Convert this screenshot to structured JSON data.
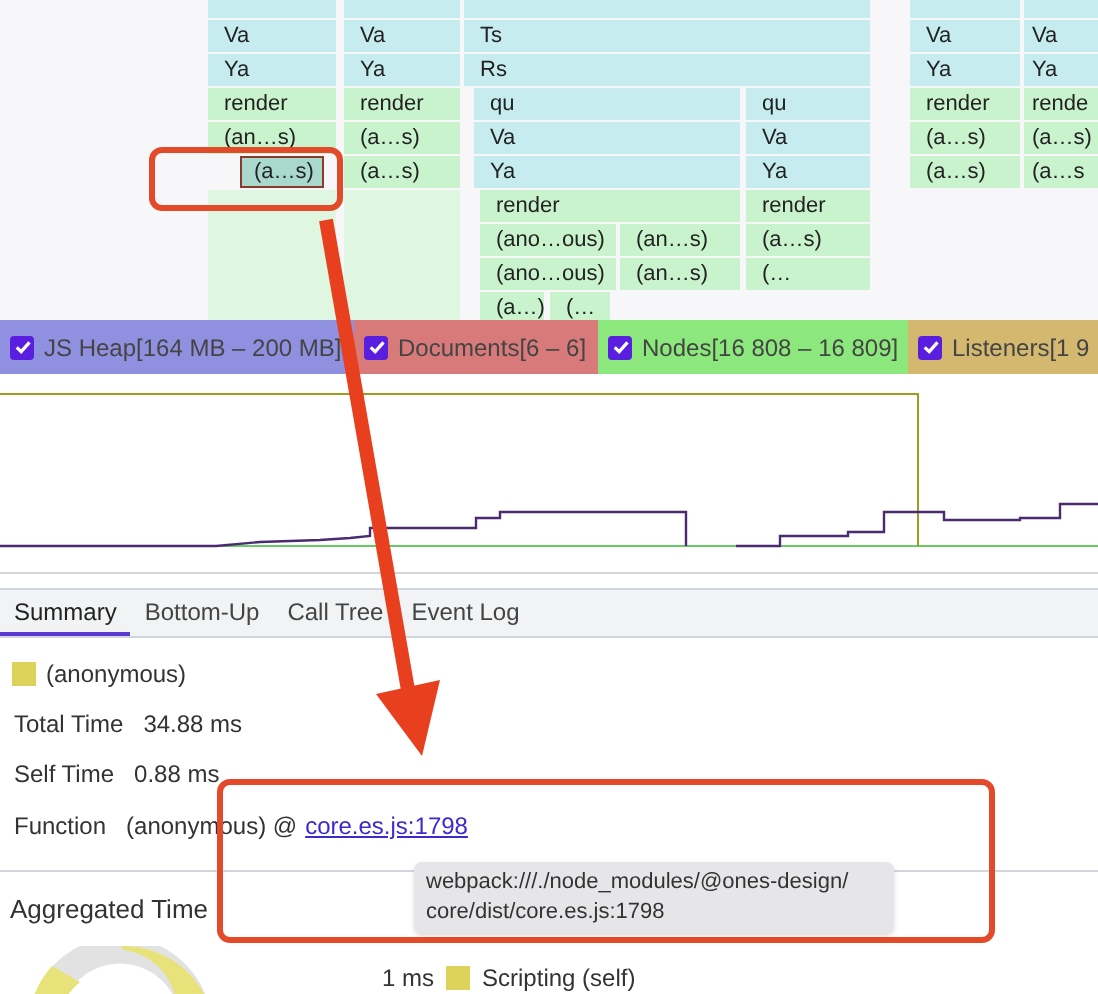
{
  "flame": {
    "stacks": [
      {
        "label": "Va",
        "selected": false,
        "children": [
          {
            "label": "Ya",
            "selected": false,
            "children": [
              {
                "label": "render",
                "selected": false,
                "children": [
                  {
                    "label": "(an…s)",
                    "selected": false,
                    "children": [
                      {
                        "label": "(a…s)",
                        "selected": true
                      }
                    ]
                  }
                ]
              }
            ]
          }
        ]
      },
      {
        "label": "Va",
        "selected": false,
        "children": [
          {
            "label": "Ya",
            "selected": false,
            "children": [
              {
                "label": "render",
                "selected": false,
                "children": [
                  {
                    "label": "(a…s)",
                    "selected": false,
                    "children": [
                      {
                        "label": "(a…s)",
                        "selected": false
                      }
                    ]
                  }
                ]
              }
            ]
          }
        ]
      },
      {
        "label": "Ts",
        "selected": false,
        "children": [
          {
            "label": "Rs",
            "selected": false,
            "children": [
              {
                "label": "qu",
                "selected": false,
                "children": [
                  {
                    "label": "Va",
                    "selected": false,
                    "children": [
                      {
                        "label": "Ya",
                        "selected": false,
                        "children": [
                          {
                            "label": "render",
                            "selected": false,
                            "children": [
                              {
                                "label": "(ano…ous)",
                                "selected": false,
                                "children": [
                                  {
                                    "label": "(ano…ous)",
                                    "selected": false,
                                    "children": [
                                      {
                                        "label": "(a…)",
                                        "selected": false
                                      },
                                      {
                                        "label": "(…",
                                        "selected": false
                                      }
                                    ]
                                  }
                                ]
                              },
                              {
                                "label": "(an…s)",
                                "selected": false,
                                "children": [
                                  {
                                    "label": "(an…s)",
                                    "selected": false
                                  }
                                ]
                              }
                            ]
                          }
                        ]
                      }
                    ]
                  }
                ]
              },
              {
                "label": "qu",
                "selected": false,
                "children": [
                  {
                    "label": "Va",
                    "selected": false,
                    "children": [
                      {
                        "label": "Ya",
                        "selected": false,
                        "children": [
                          {
                            "label": "render",
                            "selected": false,
                            "children": [
                              {
                                "label": "(a…s)",
                                "selected": false,
                                "children": [
                                  {
                                    "label": "(…",
                                    "selected": false
                                  }
                                ]
                              }
                            ]
                          }
                        ]
                      }
                    ]
                  }
                ]
              }
            ]
          }
        ]
      },
      {
        "label": "Va",
        "selected": false,
        "children": [
          {
            "label": "Ya",
            "selected": false,
            "children": [
              {
                "label": "render",
                "selected": false,
                "children": [
                  {
                    "label": "(a…s)",
                    "selected": false,
                    "children": [
                      {
                        "label": "(a…s)",
                        "selected": false
                      }
                    ]
                  }
                ]
              }
            ]
          }
        ]
      },
      {
        "label": "Va",
        "selected": false,
        "children": [
          {
            "label": "Ya",
            "selected": false,
            "children": [
              {
                "label": "rende",
                "selected": false,
                "children": [
                  {
                    "label": "(a…s)",
                    "selected": false,
                    "children": [
                      {
                        "label": "(a…s",
                        "selected": false
                      }
                    ]
                  }
                ]
              }
            ]
          }
        ]
      }
    ]
  },
  "counters": [
    {
      "label": "JS Heap[164 MB – 200 MB]",
      "checked": true,
      "color": "#9090e0"
    },
    {
      "label": "Documents[6 – 6]",
      "checked": true,
      "color": "#d87a7a"
    },
    {
      "label": "Nodes[16 808 – 16 809]",
      "checked": true,
      "color": "#8ce87c"
    },
    {
      "label": "Listeners[1 9",
      "checked": true,
      "color": "#d4b870"
    }
  ],
  "tabs": [
    {
      "label": "Summary",
      "selected": true
    },
    {
      "label": "Bottom-Up",
      "selected": false
    },
    {
      "label": "Call Tree",
      "selected": false
    },
    {
      "label": "Event Log",
      "selected": false
    }
  ],
  "summary": {
    "title": "(anonymous)",
    "fields": [
      {
        "label": "Total Time",
        "value": "34.88 ms"
      },
      {
        "label": "Self Time",
        "value": "0.88 ms"
      }
    ],
    "function": {
      "label": "Function",
      "value": "(anonymous) @",
      "link": "core.es.js:1798"
    },
    "tooltip": [
      "webpack:///./node_modules/@ones-design/",
      "core/dist/core.es.js:1798"
    ]
  },
  "aggregated": {
    "title": "Aggregated Time",
    "legend": [
      {
        "value": "1 ms",
        "label": "Scripting (self)"
      }
    ]
  }
}
